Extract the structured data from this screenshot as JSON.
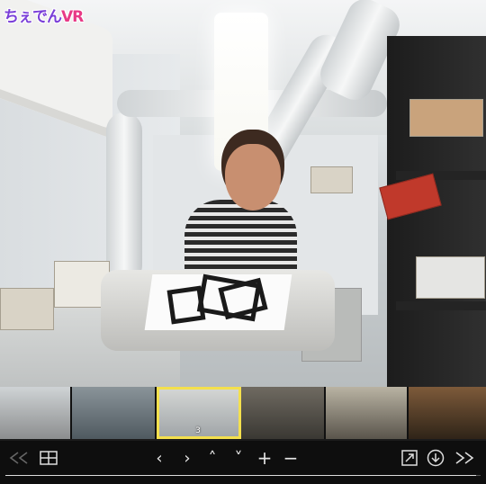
{
  "app": {
    "logo_text": "ちぇでん",
    "logo_suffix": "VR"
  },
  "thumbnails": [
    {
      "label": "",
      "active": false
    },
    {
      "label": "",
      "active": false
    },
    {
      "label": "3",
      "active": true
    },
    {
      "label": "",
      "active": false
    },
    {
      "label": "",
      "active": false
    },
    {
      "label": "",
      "active": false
    }
  ],
  "controls": {
    "prev_scene": "first-scene-icon",
    "grid": "grid-icon",
    "left": "‹",
    "right": "›",
    "up": "˄",
    "down": "˅",
    "zoom_in": "+",
    "zoom_out": "−",
    "fullscreen": "fullscreen-icon",
    "download": "download-icon",
    "next_scene": "last-scene-icon",
    "progress": 0.99
  },
  "colors": {
    "accent": "#f4e04d",
    "logo": "#7a3fd8",
    "logo_vr": "#e83a86"
  }
}
